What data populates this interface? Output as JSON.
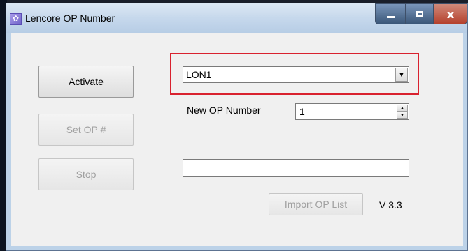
{
  "window": {
    "title": "Lencore OP Number",
    "icon": "app-icon",
    "controls": {
      "minimize_icon": "minimize-icon",
      "maximize_icon": "maximize-icon",
      "close_glyph": "x"
    }
  },
  "buttons": {
    "activate": "Activate",
    "set_op": "Set OP #",
    "stop": "Stop",
    "import_op_list": "Import OP List"
  },
  "combo": {
    "selected": "LON1",
    "arrow_glyph": "▼"
  },
  "new_op": {
    "label": "New OP Number",
    "value": "1",
    "up_glyph": "▲",
    "down_glyph": "▼"
  },
  "status_text": "",
  "version": "V 3.3",
  "colors": {
    "highlight": "#d9222f",
    "disabled_text": "#a0a0a0"
  }
}
